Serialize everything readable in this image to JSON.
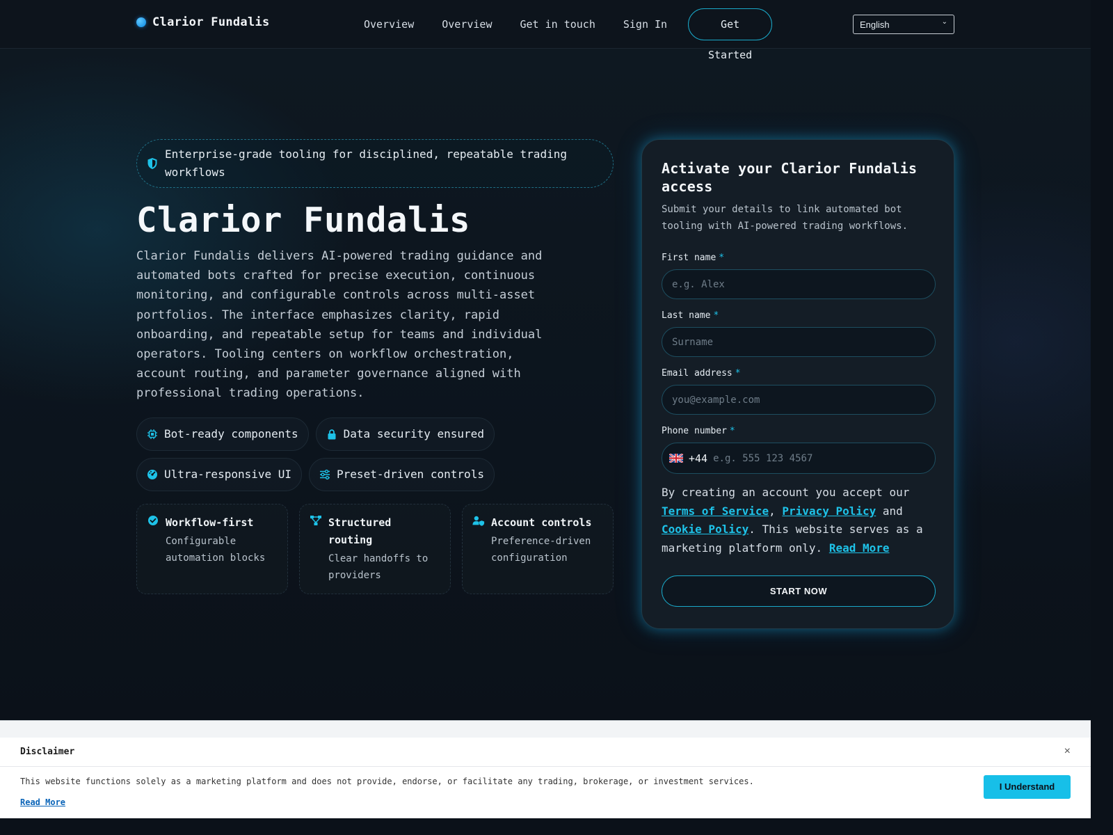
{
  "header": {
    "brand": "Clarior Fundalis",
    "nav": [
      "Overview",
      "Overview",
      "Get in touch",
      "Sign In"
    ],
    "cta": "Get Started",
    "language": "English"
  },
  "hero": {
    "banner": "Enterprise-grade tooling for disciplined, repeatable trading workflows",
    "title": "Clarior Fundalis",
    "description": "Clarior Fundalis delivers AI-powered trading guidance and automated bots crafted for precise execution, continuous monitoring, and configurable controls across multi-asset portfolios. The interface emphasizes clarity, rapid onboarding, and repeatable setup for teams and individual operators. Tooling centers on workflow orchestration, account routing, and parameter governance aligned with professional trading operations.",
    "chips": [
      {
        "label": "Bot-ready components",
        "icon": "chip-icon"
      },
      {
        "label": "Data security ensured",
        "icon": "lock-icon"
      },
      {
        "label": "Ultra-responsive UI",
        "icon": "gauge-icon"
      },
      {
        "label": "Preset-driven controls",
        "icon": "sliders-icon"
      }
    ],
    "cards": [
      {
        "title": "Workflow-first",
        "subtitle": "Configurable automation blocks",
        "icon": "check-badge-icon"
      },
      {
        "title": "Structured routing",
        "subtitle": "Clear handoffs to providers",
        "icon": "routing-icon"
      },
      {
        "title": "Account controls",
        "subtitle": "Preference-driven configuration",
        "icon": "user-shield-icon"
      }
    ]
  },
  "form": {
    "title": "Activate your Clarior Fundalis access",
    "lead": "Submit your details to link automated bot tooling with AI-powered trading workflows.",
    "first_name": {
      "label": "First name",
      "required": "*",
      "placeholder": "e.g. Alex"
    },
    "last_name": {
      "label": "Last name",
      "required": "*",
      "placeholder": "Surname"
    },
    "email": {
      "label": "Email address",
      "required": "*",
      "placeholder": "you@example.com"
    },
    "phone": {
      "label": "Phone number",
      "required": "*",
      "country_code": "+44",
      "placeholder": "e.g. 555 123 4567"
    },
    "terms": {
      "prefix": "By creating an account you accept our",
      "tos": "Terms of Service",
      "comma": ",",
      "privacy": "Privacy Policy",
      "and": "and",
      "cookie": "Cookie Policy",
      "suffix": ". This website serves as a marketing platform only.",
      "read_more": "Read More"
    },
    "submit": "START NOW"
  },
  "disclaimer": {
    "title": "Disclaimer",
    "close": "×",
    "text": "This website functions solely as a marketing platform and does not provide, endorse, or facilitate any trading, brokerage, or investment services.",
    "read_more": "Read More",
    "button": "I Understand"
  },
  "colors": {
    "accent": "#1ec2e8",
    "background": "#0b1119",
    "card": "#141d26"
  }
}
